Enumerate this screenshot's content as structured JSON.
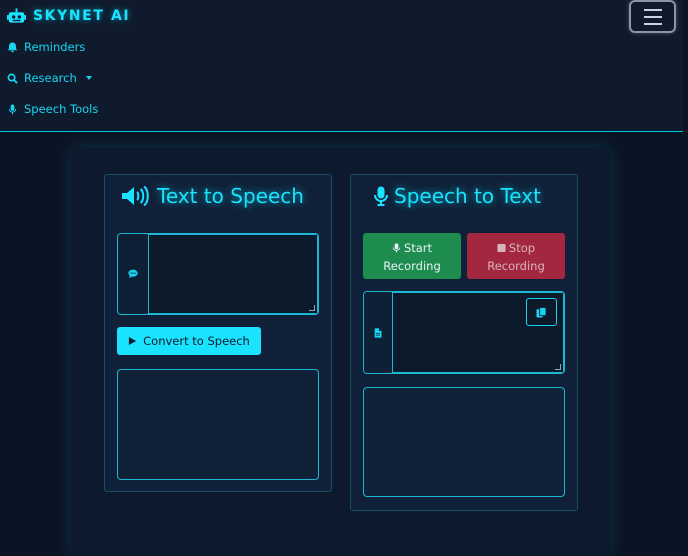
{
  "navbar": {
    "brand": "SKYNET AI",
    "brand_icon": "robot-icon",
    "toggler_icon": "hamburger-icon",
    "items": [
      {
        "label": "Reminders",
        "icon": "bell-icon"
      },
      {
        "label": "Research",
        "icon": "search-icon",
        "dropdown": true
      },
      {
        "label": "Speech Tools",
        "icon": "microphone-icon"
      }
    ]
  },
  "tts": {
    "title": "Text to Speech",
    "title_icon": "volume-icon",
    "input_icon": "comment-icon",
    "input_value": "",
    "convert_label": "Convert to Speech",
    "convert_icon": "play-icon"
  },
  "stt": {
    "title": "Speech to Text",
    "title_icon": "microphone-icon",
    "start_label": "Start Recording",
    "stop_label": "Stop Recording",
    "start_icon": "microphone-icon",
    "stop_icon": "stop-icon",
    "input_icon": "file-icon",
    "copy_icon": "copy-icon",
    "input_value": ""
  },
  "colors": {
    "accent": "#19e3ff",
    "background": "#0b1424",
    "start": "#1e8c4f",
    "stop": "#a3283f"
  }
}
